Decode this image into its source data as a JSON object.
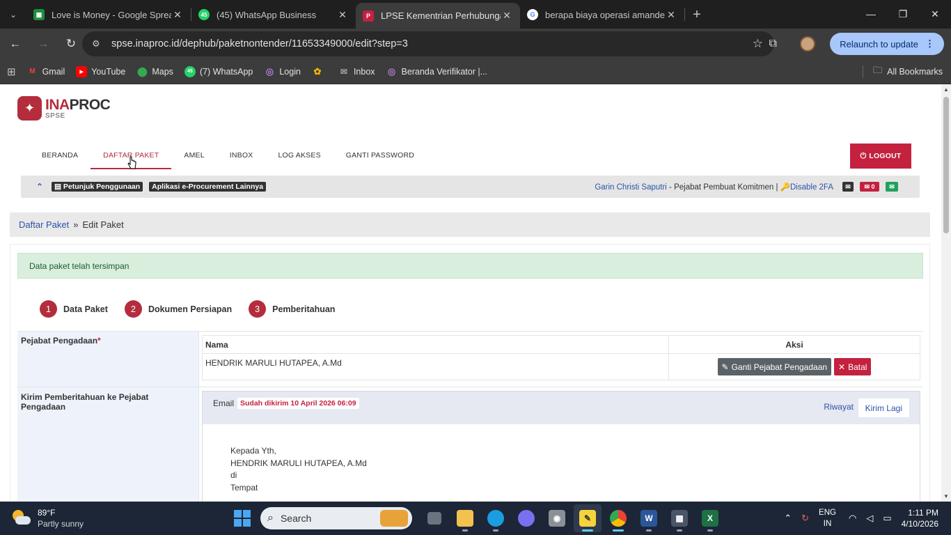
{
  "browser": {
    "tabs": [
      {
        "title": "Love is Money - Google Spread",
        "favicon": "sheets-icon",
        "color": "#1e8e3e",
        "glyph": "▦"
      },
      {
        "title": "(45) WhatsApp Business",
        "favicon": "whatsapp-icon",
        "color": "#25d366",
        "glyph": "45"
      },
      {
        "title": "LPSE Kementrian Perhubungan",
        "favicon": "lpse-icon",
        "color": "#c4213f",
        "glyph": "P"
      },
      {
        "title": "berapa biaya operasi amandel -",
        "favicon": "google-icon",
        "color": "#ffffff",
        "glyph": "G"
      }
    ],
    "url": "spse.inaproc.id/dephub/paketnontender/11653349000/edit?step=3",
    "relaunch_label": "Relaunch to update",
    "bookmarks": [
      {
        "label": "Gmail",
        "color": "#ea4335",
        "glyph": "M"
      },
      {
        "label": "YouTube",
        "color": "#ff0000",
        "glyph": "▶"
      },
      {
        "label": "Maps",
        "color": "#34a853",
        "glyph": "●"
      },
      {
        "label": "(7) WhatsApp",
        "color": "#25d366",
        "glyph": "45"
      },
      {
        "label": "Login",
        "color": "#7b4fa1",
        "glyph": "◎"
      },
      {
        "label": "",
        "color": "#f4b400",
        "glyph": "✿"
      },
      {
        "label": "Inbox",
        "color": "#5f6368",
        "glyph": "✉"
      },
      {
        "label": "Beranda Verifikator |...",
        "color": "#7b4fa1",
        "glyph": "◎"
      }
    ],
    "all_bookmarks_label": "All Bookmarks"
  },
  "site": {
    "logo_ina": "INA",
    "logo_proc": "PROC",
    "logo_sub": "SPSE",
    "nav": [
      {
        "label": "BERANDA",
        "active": false
      },
      {
        "label": "DAFTAR PAKET",
        "active": true
      },
      {
        "label": "AMEL",
        "active": false
      },
      {
        "label": "INBOX",
        "active": false
      },
      {
        "label": "LOG AKSES",
        "active": false
      },
      {
        "label": "GANTI PASSWORD",
        "active": false
      }
    ],
    "logout_label": "LOGOUT",
    "info": {
      "petunjuk": "Petunjuk Penggunaan",
      "aplikasi": "Aplikasi e-Procurement Lainnya",
      "user_name": "Garin Christi Saputri",
      "user_role": " - Pejabat Pembuat Komitmen | ",
      "disable_2fa": "Disable 2FA",
      "mail_count": "0"
    },
    "breadcrumb": {
      "parent": "Daftar Paket",
      "sep": "»",
      "current": "Edit Paket"
    },
    "alert": "Data paket telah tersimpan",
    "steps": [
      {
        "num": "1",
        "label": "Data Paket"
      },
      {
        "num": "2",
        "label": "Dokumen Persiapan"
      },
      {
        "num": "3",
        "label": "Pemberitahuan"
      }
    ],
    "pejabat": {
      "label": "Pejabat Pengadaan",
      "required_mark": "*",
      "col_nama": "Nama",
      "col_aksi": "Aksi",
      "name": "HENDRIK MARULI HUTAPEA, A.Md",
      "ganti_label": "Ganti Pejabat Pengadaan",
      "batal_label": "Batal"
    },
    "kirim": {
      "label": "Kirim Pemberitahuan ke Pejabat Pengadaan",
      "email_label": "Email",
      "sent_badge": "Sudah dikirim 10 April 2026 06:09",
      "riwayat": "Riwayat",
      "kirim_lagi": "Kirim Lagi",
      "body_lines": [
        "Kepada Yth,",
        "HENDRIK MARULI HUTAPEA, A.Md",
        "di",
        "Tempat"
      ]
    }
  },
  "taskbar": {
    "temp": "89°F",
    "condition": "Partly sunny",
    "search_placeholder": "Search",
    "lang_top": "ENG",
    "lang_bottom": "IN",
    "time": "1:11 PM",
    "date": "4/10/2026"
  }
}
